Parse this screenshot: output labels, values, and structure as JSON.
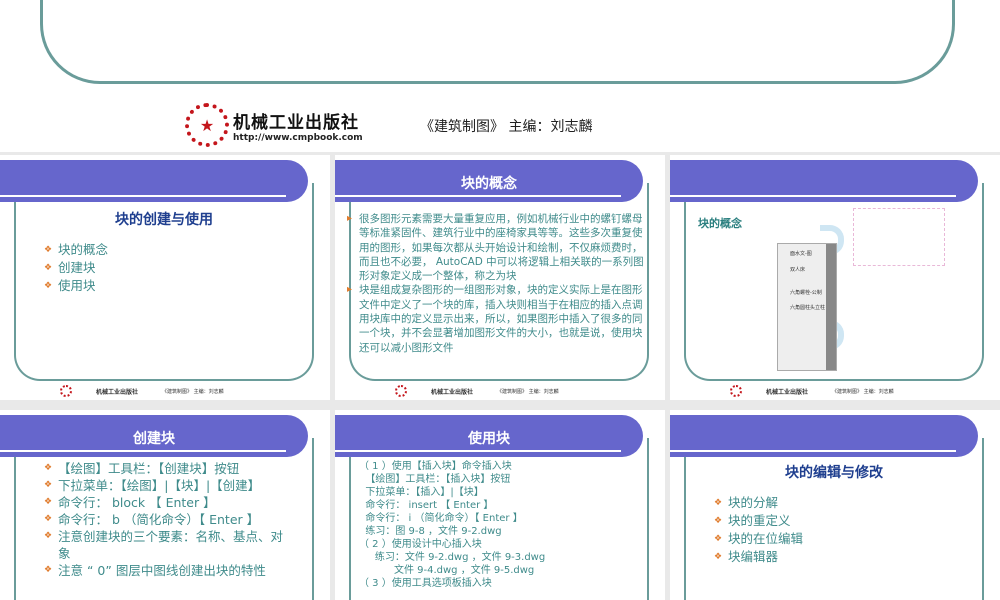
{
  "header": {
    "publisher": "机械工业出版社",
    "url": "http://www.cmpbook.com",
    "book": "《建筑制图》  主编：刘志麟"
  },
  "footer": {
    "publisher": "机械工业出版社",
    "book": "《建筑制图》 主编：刘志麟"
  },
  "slides": [
    {
      "title": "块的创建与使用",
      "items": [
        "块的概念",
        "创建块",
        "使用块"
      ]
    },
    {
      "band": "块的概念",
      "paragraphs": [
        "很多图形元素需要大量重复应用，例如机械行业中的螺钉螺母等标准紧固件、建筑行业中的座椅家具等等。这些多次重复使用的图形，如果每次都从头开始设计和绘制，不仅麻烦费时，而且也不必要， AutoCAD 中可以将逻辑上相关联的一系列图形对象定义成一个整体，称之为块",
        "块是组成复杂图形的一组图形对象，块的定义实际上是在图形文件中定义了一个块的库，插入块则相当于在相应的插入点调用块库中的定义显示出来，所以，如果图形中插入了很多的同一个块，并不会显著增加图形文件的大小，也就是说，使用块还可以减小图形文件"
      ]
    },
    {
      "title": "块的概念",
      "palette_items": [
        "面水文-图",
        "双人床",
        "六角螺栓-公制",
        "六角圆柱头立柱（..."
      ]
    },
    {
      "band": "创建块",
      "items": [
        "【绘图】工具栏：【创建块】按钮",
        "下拉菜单：【绘图】|【块】|【创建】",
        "命令行： block 【 Enter 】",
        "命令行： b （简化命令）【 Enter 】",
        "注意创建块的三个要素：名称、基点、对象",
        "注意 “ 0” 图层中图线创建出块的特性"
      ]
    },
    {
      "band": "使用块",
      "lines": [
        "（ 1 ）使用【插入块】命令插入块",
        "  【绘图】工具栏：【插入块】按钮",
        "  下拉菜单：【插入】|【块】",
        "  命令行： insert 【 Enter 】",
        "  命令行： i （简化命令）【 Enter 】",
        "  练习：图 9-8 ，文件 9-2.dwg",
        "（ 2 ）使用设计中心插入块",
        "     练习：文件 9-2.dwg ，文件 9-3.dwg",
        "           文件 9-4.dwg ，文件 9-5.dwg",
        "（ 3 ）使用工具选项板插入块"
      ]
    },
    {
      "title": "块的编辑与修改",
      "items": [
        "块的分解",
        "块的重定义",
        "块的在位编辑",
        "块编辑器"
      ]
    }
  ]
}
